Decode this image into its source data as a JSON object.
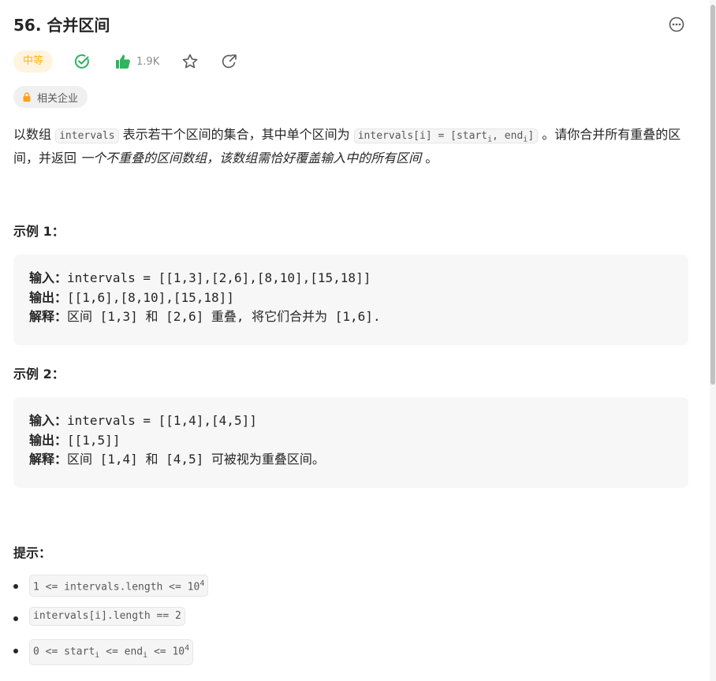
{
  "problem": {
    "title": "56. 合并区间",
    "difficulty": "中等",
    "like_count": "1.9K",
    "company_tag": "相关企业"
  },
  "description": {
    "t1": "以数组 ",
    "c1": "intervals",
    "t2": " 表示若干个区间的集合，其中单个区间为 ",
    "c2a": "intervals[i] = [start",
    "c2b": "i",
    "c2c": ", end",
    "c2d": "i",
    "c2e": "]",
    "t3": " 。请你合并所有重叠的区间，并返回 ",
    "em": "一个不重叠的区间数组，该数组需恰好覆盖输入中的所有区间",
    "t4": " 。"
  },
  "examples": [
    {
      "title": "示例 1：",
      "input_key": "输入：",
      "input": "intervals = [[1,3],[2,6],[8,10],[15,18]]",
      "output_key": "输出：",
      "output": "[[1,6],[8,10],[15,18]]",
      "explain_key": "解释：",
      "explain": "区间 [1,3] 和 [2,6] 重叠, 将它们合并为 [1,6]."
    },
    {
      "title": "示例 2：",
      "input_key": "输入：",
      "input": "intervals = [[1,4],[4,5]]",
      "output_key": "输出：",
      "output": "[[1,5]]",
      "explain_key": "解释：",
      "explain": "区间 [1,4] 和 [4,5] 可被视为重叠区间。"
    }
  ],
  "hints_title": "提示：",
  "hints": {
    "h1a": "1 <= intervals.length <= 10",
    "h1sup": "4",
    "h2": "intervals[i].length == 2",
    "h3a": "0 <= start",
    "h3sub1": "i",
    "h3b": " <= end",
    "h3sub2": "i",
    "h3c": " <= 10",
    "h3sup": "4"
  },
  "colors": {
    "difficulty_bg": "#fff4e0",
    "difficulty_text": "#ffb800",
    "solved_green": "#2db55d",
    "like_green": "#2db55d",
    "lock_orange": "#ffa116"
  },
  "icons": [
    "more-options-icon",
    "solved-check-icon",
    "thumbs-up-icon",
    "star-icon",
    "share-icon",
    "lock-icon"
  ]
}
